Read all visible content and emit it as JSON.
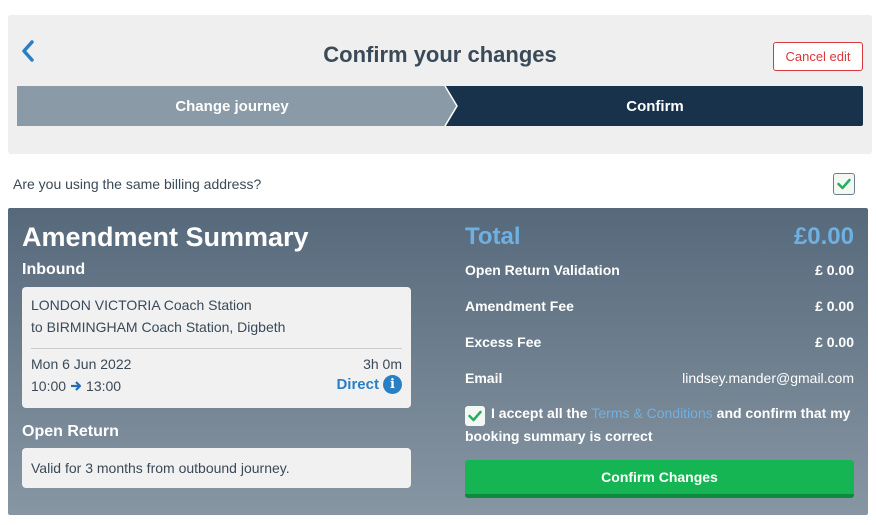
{
  "header": {
    "title": "Confirm your changes",
    "cancel_label": "Cancel edit"
  },
  "steps": [
    {
      "label": "Change journey",
      "state": "completed"
    },
    {
      "label": "Confirm",
      "state": "current"
    }
  ],
  "billing": {
    "question": "Are you using the same billing address?",
    "checked": true
  },
  "summary": {
    "title": "Amendment Summary",
    "inbound": {
      "label": "Inbound",
      "from": "LONDON VICTORIA Coach Station",
      "to": "to BIRMINGHAM Coach Station, Digbeth",
      "date": "Mon 6 Jun 2022",
      "duration": "3h 0m",
      "depart": "10:00",
      "arrive": "13:00",
      "type": "Direct"
    },
    "open_return": {
      "label": "Open Return",
      "text": "Valid for 3 months from outbound journey."
    }
  },
  "totals": {
    "total_label": "Total",
    "total_value": "£0.00",
    "rows": [
      {
        "label": "Open Return Validation",
        "value": "£ 0.00"
      },
      {
        "label": "Amendment Fee",
        "value": "£ 0.00"
      },
      {
        "label": "Excess Fee",
        "value": "£ 0.00"
      },
      {
        "label": "Email",
        "value": "lindsey.mander@gmail.com"
      }
    ],
    "accept": {
      "prefix": "I accept all the",
      "link": "Terms & Conditions",
      "suffix": "and confirm that my booking summary is correct",
      "checked": true
    },
    "confirm_label": "Confirm Changes"
  },
  "colors": {
    "step_completed": "#8a9aa6",
    "step_current": "#17324a",
    "accent_blue": "#6fb0e2",
    "confirm_green": "#16b553",
    "cancel_red": "#d9383f",
    "check_green": "#27ae60"
  },
  "icons": {
    "back": "chevron-left-icon",
    "check": "checkmark-icon",
    "arrow": "arrow-right-icon",
    "info": "info-icon"
  }
}
